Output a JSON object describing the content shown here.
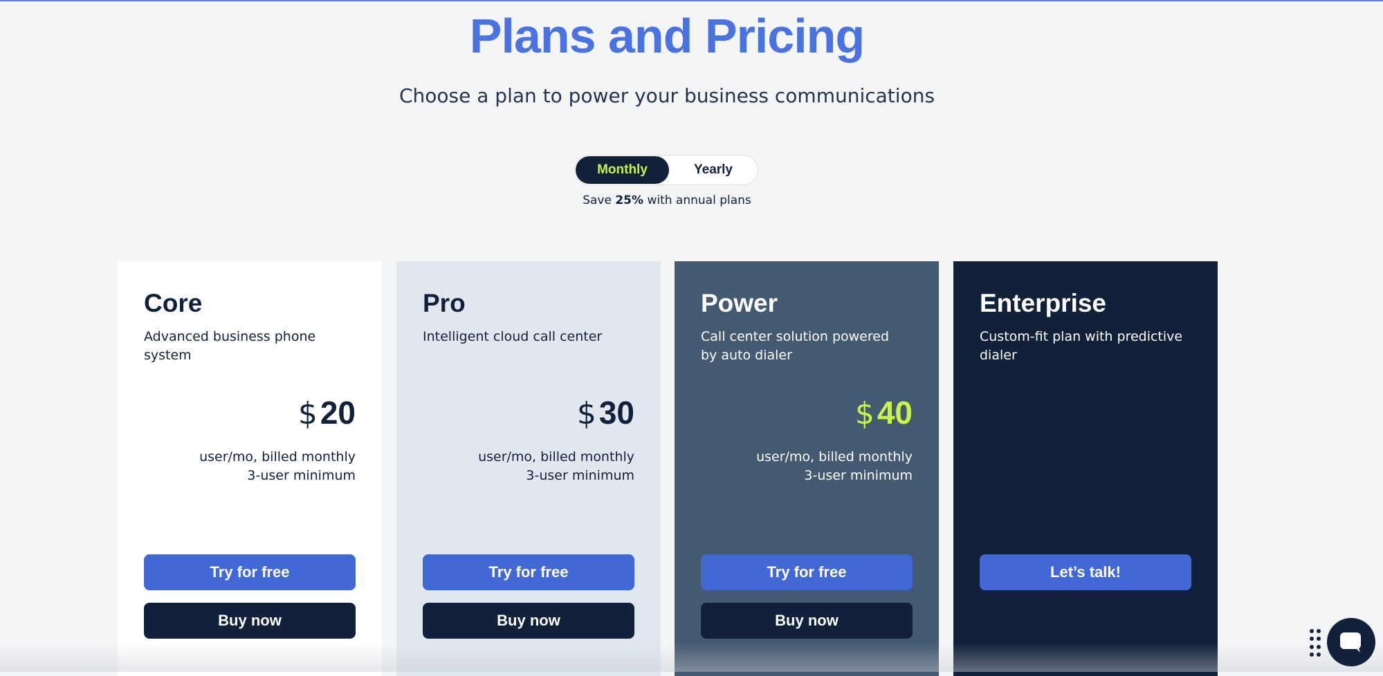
{
  "header": {
    "title": "Plans and Pricing",
    "subtitle": "Choose a plan to power your business communications"
  },
  "billing_toggle": {
    "options": [
      "Monthly",
      "Yearly"
    ],
    "selected": "Monthly",
    "note_prefix": "Save ",
    "note_highlight": "25%",
    "note_suffix": " with annual plans"
  },
  "plans": [
    {
      "name": "Core",
      "description": "Advanced business phone system",
      "currency": "$",
      "price": "20",
      "billing_line1": "user/mo, billed monthly",
      "billing_line2": "3-user minimum",
      "try_label": "Try for free",
      "buy_label": "Buy now"
    },
    {
      "name": "Pro",
      "description": "Intelligent cloud call center",
      "currency": "$",
      "price": "30",
      "billing_line1": "user/mo, billed monthly",
      "billing_line2": "3-user minimum",
      "try_label": "Try for free",
      "buy_label": "Buy now"
    },
    {
      "name": "Power",
      "description": "Call center solution powered by auto dialer",
      "currency": "$",
      "price": "40",
      "billing_line1": "user/mo, billed monthly",
      "billing_line2": "3-user minimum",
      "try_label": "Try for free",
      "buy_label": "Buy now"
    },
    {
      "name": "Enterprise",
      "description": "Custom-fit plan with predictive dialer",
      "cta_label": "Let’s talk!"
    }
  ],
  "icons": {
    "chat": "chat-bubble-icon",
    "grip": "drag-grip-icon"
  },
  "colors": {
    "accent_blue": "#4a72e1",
    "button_blue": "#4168d4",
    "navy": "#12213a",
    "lime_highlight": "#c9f24b",
    "slate_card": "#445a70",
    "light_card": "#e1e7ef"
  }
}
